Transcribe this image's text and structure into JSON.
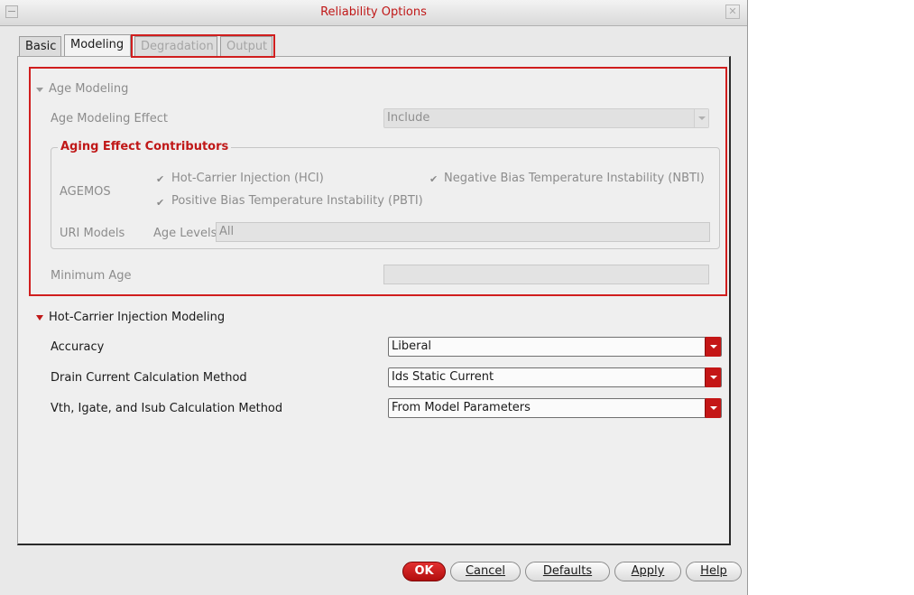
{
  "window": {
    "title": "Reliability Options",
    "close_glyph": "✕"
  },
  "tabs": [
    {
      "label": "Basic",
      "state": "normal"
    },
    {
      "label": "Modeling",
      "state": "active"
    },
    {
      "label": "Degradation",
      "state": "disabled"
    },
    {
      "label": "Output",
      "state": "disabled"
    }
  ],
  "age_modeling": {
    "section_label": "Age Modeling",
    "effect_label": "Age Modeling Effect",
    "effect_value": "Include",
    "group_title": "Aging Effect Contributors",
    "agemos_label": "AGEMOS",
    "hci_checkbox": {
      "label": "Hot-Carrier Injection (HCI)",
      "checked": true
    },
    "nbti_checkbox": {
      "label": "Negative Bias Temperature Instability (NBTI)",
      "checked": true
    },
    "pbti_checkbox": {
      "label": "Positive Bias Temperature Instability (PBTI)",
      "checked": true
    },
    "uri_label": "URI Models",
    "age_levels_label": "Age Levels",
    "age_levels_value": "All",
    "min_age_label": "Minimum Age",
    "min_age_value": ""
  },
  "hci_modeling": {
    "section_label": "Hot-Carrier Injection Modeling",
    "accuracy_label": "Accuracy",
    "accuracy_value": "Liberal",
    "drain_label": "Drain Current Calculation Method",
    "drain_value": "Ids Static Current",
    "vth_label": "Vth, Igate, and Isub Calculation Method",
    "vth_value": "From Model Parameters"
  },
  "buttons": {
    "ok": "OK",
    "cancel": "Cancel",
    "defaults": "Defaults",
    "apply": "Apply",
    "help": "Help"
  },
  "colors": {
    "accent": "#c01818",
    "highlight_box": "#d01e1e"
  }
}
